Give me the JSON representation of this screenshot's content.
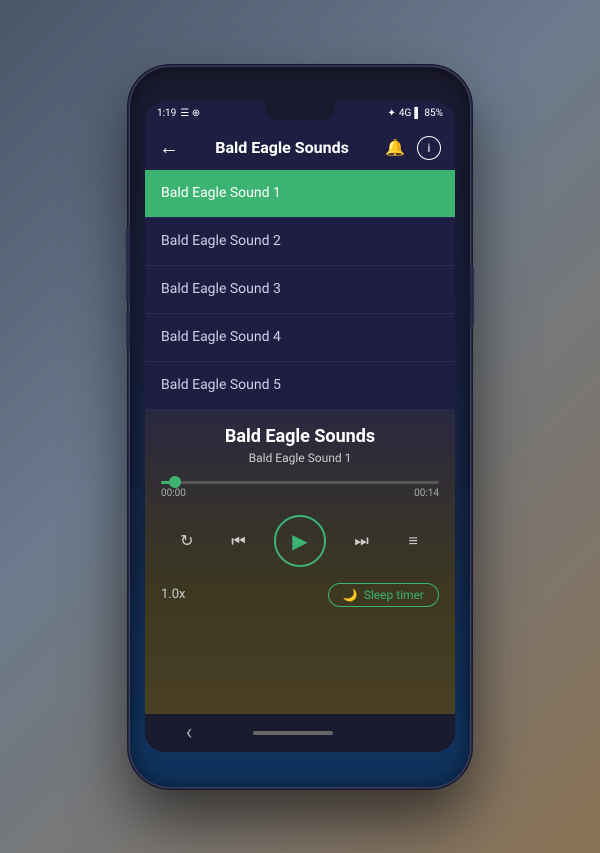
{
  "phone": {
    "status_bar": {
      "time": "1:19",
      "battery": "85%",
      "signal": "4G"
    },
    "top_bar": {
      "title": "Bald Eagle Sounds",
      "back_label": "←",
      "bell_label": "🔔",
      "info_label": "i"
    },
    "songs": [
      {
        "id": 1,
        "label": "Bald Eagle Sound 1",
        "active": true
      },
      {
        "id": 2,
        "label": "Bald Eagle Sound 2",
        "active": false
      },
      {
        "id": 3,
        "label": "Bald Eagle Sound 3",
        "active": false
      },
      {
        "id": 4,
        "label": "Bald Eagle Sound 4",
        "active": false
      },
      {
        "id": 5,
        "label": "Bald Eagle Sound 5",
        "active": false
      }
    ],
    "player": {
      "album_title": "Bald Eagle Sounds",
      "current_track": "Bald Eagle Sound 1",
      "time_current": "00:00",
      "time_total": "00:14",
      "speed": "1.0x",
      "sleep_timer_label": "Sleep timer",
      "progress_percent": 5
    },
    "controls": {
      "repeat": "↻",
      "prev": "⏮",
      "play": "▶",
      "next": "⏭",
      "playlist": "≡"
    },
    "nav_bar": {
      "back_label": "‹",
      "home_indicator": ""
    }
  }
}
